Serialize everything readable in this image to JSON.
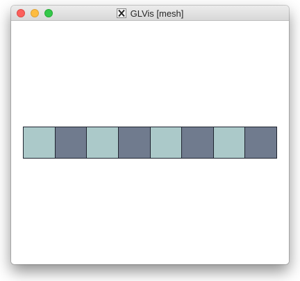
{
  "window": {
    "title": "GLVis [mesh]",
    "controls": [
      "close",
      "minimize",
      "zoom"
    ]
  },
  "title_icon": "x11-icon",
  "mesh": {
    "element_count": 8,
    "element_colors": [
      "#abc9c9",
      "#707b8e",
      "#abc9c9",
      "#707b8e",
      "#abc9c9",
      "#707b8e",
      "#abc9c9",
      "#707b8e"
    ],
    "edge_color": "#1f2430"
  }
}
